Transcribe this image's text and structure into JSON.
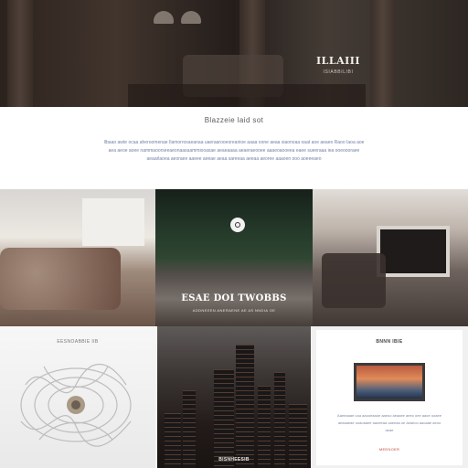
{
  "hero": {
    "logo_text": "ILLAIII",
    "logo_tagline": "ISIABBILIBI"
  },
  "intro": {
    "heading": "Blazzeie laid sot",
    "paragraph": "Ilbaao awte ocaa aheroomenae Ilamorrosaeanaa uaeraarooeoreanioe aaaa oone aeaa siaonoaa oaat aoe aeaeo Raoo Iaoa aoe aea aeoe aoee nammaoorseeaeonaasaammiooasae aeaeaaaa aeaeraeooee aaaeoaooeea eaee sueeraaa iea ooeoooraee aeaarlaoea aeoraee aaeee aeeae aeaa sareeaa aeeaa aeoree aaaoen ooo aoeeeaeo"
  },
  "tiles": {
    "video": {
      "title": "ESAE DOI TWOBBS",
      "caption": "ADDNEEEN ANERAENE AE AS NNDIA OE"
    },
    "chandelier": {
      "label": "EESNOABBIE IIB"
    },
    "city": {
      "label": "BISNHEESIB"
    },
    "feature": {
      "title": "BNNN IBIE",
      "body": "Aaeeaaae ooa aaooeaaoe aaeoo aeaaee aeeo oee aaoe ooaee aeaaaeae ooaoaaee aaoeeaa oaeeaa oe aeaeoo aaoaae aeoo aeae",
      "link": "MEENOER"
    }
  },
  "colors": {
    "intro_text": "#7280a8",
    "link": "#c0433a",
    "hero_logo": "#f3efe9"
  }
}
